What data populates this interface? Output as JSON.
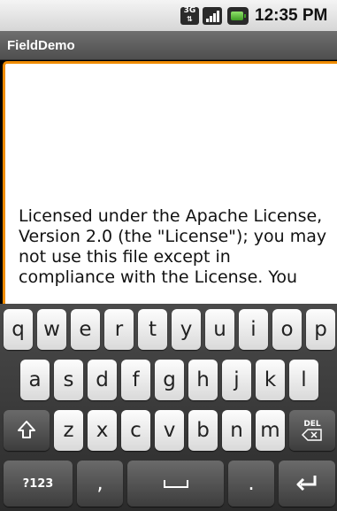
{
  "status_bar": {
    "network_label": "3G",
    "network_arrows": "⇅",
    "time": "12:35 PM",
    "icons": [
      "3g-icon",
      "signal-icon",
      "battery-icon"
    ]
  },
  "app": {
    "title": "FieldDemo"
  },
  "edit_field": {
    "value": "Licensed under the Apache License,\nVersion 2.0 (the \"License\"); you may\nnot use this file except in\ncompliance with the License. You",
    "focus_color": "#f08c00"
  },
  "keyboard": {
    "row1": [
      "q",
      "w",
      "e",
      "r",
      "t",
      "y",
      "u",
      "i",
      "o",
      "p"
    ],
    "row2": [
      "a",
      "s",
      "d",
      "f",
      "g",
      "h",
      "j",
      "k",
      "l"
    ],
    "row3": [
      "z",
      "x",
      "c",
      "v",
      "b",
      "n",
      "m"
    ],
    "shift_icon": "shift-icon",
    "delete_label": "DEL",
    "symbols_label": "?123",
    "comma": ",",
    "period": ".",
    "space_icon": "space-icon",
    "enter_icon": "enter-icon"
  }
}
